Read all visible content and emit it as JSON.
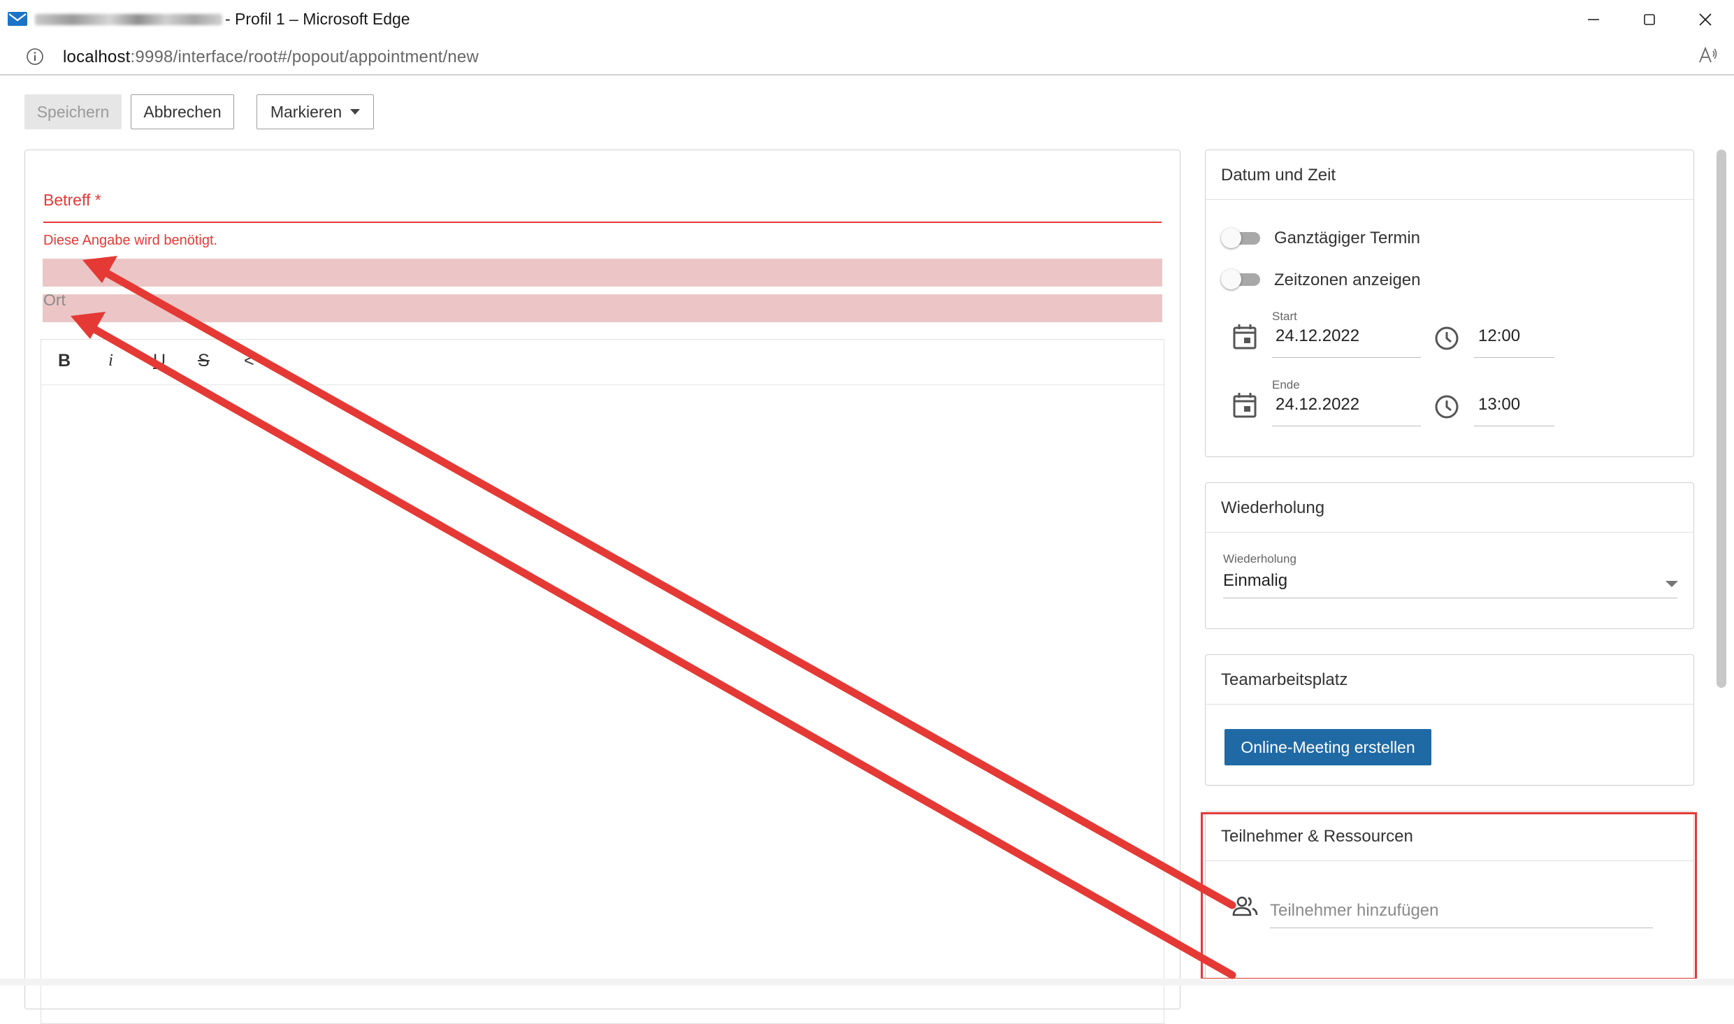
{
  "window": {
    "title_suffix": "- Profil 1 – Microsoft Edge",
    "url_host": "localhost",
    "url_rest": ":9998/interface/root#/popout/appointment/new"
  },
  "toolbar": {
    "save_label": "Speichern",
    "cancel_label": "Abbrechen",
    "mark_label": "Markieren"
  },
  "form": {
    "subject_label": "Betreff *",
    "subject_error": "Diese Angabe wird benötigt.",
    "location_placeholder": "Ort",
    "editor_tools": [
      "B",
      "i",
      "U",
      "S",
      "<"
    ]
  },
  "datetime": {
    "header": "Datum und Zeit",
    "allday_label": "Ganztägiger Termin",
    "timezones_label": "Zeitzonen anzeigen",
    "start_label": "Start",
    "start_date": "24.12.2022",
    "start_time": "12:00",
    "end_label": "Ende",
    "end_date": "24.12.2022",
    "end_time": "13:00"
  },
  "recurrence": {
    "header": "Wiederholung",
    "field_label": "Wiederholung",
    "value": "Einmalig"
  },
  "teamwork": {
    "header": "Teamarbeitsplatz",
    "button_label": "Online-Meeting erstellen"
  },
  "attendees": {
    "header": "Teilnehmer & Ressourcen",
    "placeholder": "Teilnehmer hinzufügen"
  },
  "colors": {
    "error": "#e53935",
    "primary": "#1f6aa5",
    "highlight": "#ecc6c6"
  }
}
